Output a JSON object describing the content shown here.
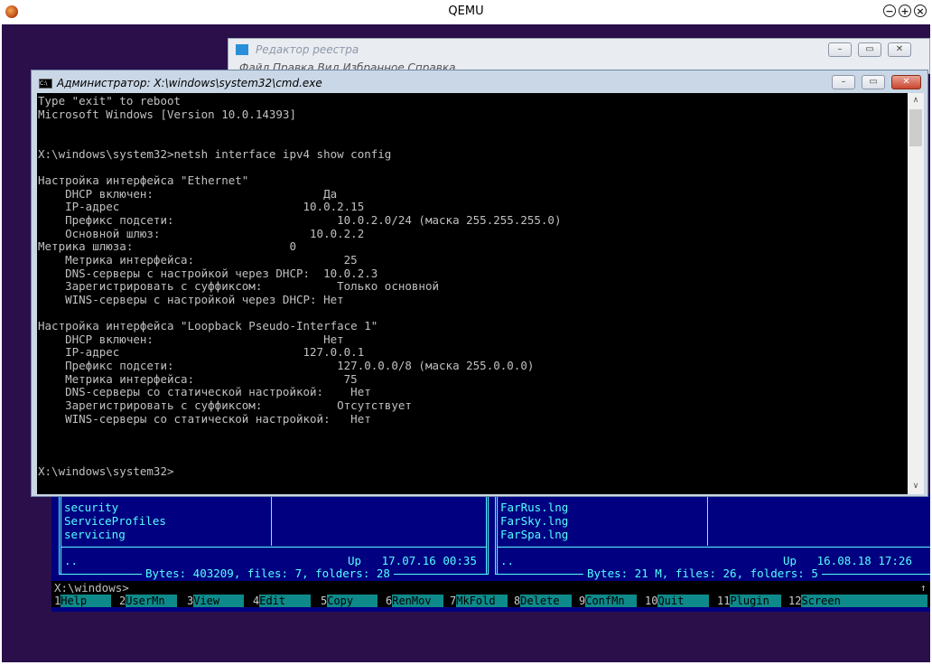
{
  "qemu": {
    "title": "QEMU",
    "minimize_glyph": "−",
    "maximize_glyph": "+",
    "close_glyph": "×"
  },
  "regedit": {
    "title": "Редактор реестра",
    "menu": "Файл   Правка   Вид   Избранное   Справка"
  },
  "cmd": {
    "title": "Администратор: X:\\windows\\system32\\cmd.exe",
    "lines": [
      "Type \"exit\" to reboot",
      "Microsoft Windows [Version 10.0.14393]",
      "",
      "",
      "X:\\windows\\system32>netsh interface ipv4 show config",
      "",
      "Настройка интерфейса \"Ethernet\"",
      "    DHCP включен:                         Да",
      "    IP-адрес                           10.0.2.15",
      "    Префикс подсети:                        10.0.2.0/24 (маска 255.255.255.0)",
      "    Основной шлюз:                      10.0.2.2",
      "Метрика шлюза:                       0",
      "    Метрика интерфейса:                      25",
      "    DNS-серверы с настройкой через DHCP:  10.0.2.3",
      "    Зарегистрировать с суффиксом:           Только основной",
      "    WINS-серверы с настройкой через DHCP: Нет",
      "",
      "Настройка интерфейса \"Loopback Pseudo-Interface 1\"",
      "    DHCP включен:                         Нет",
      "    IP-адрес                           127.0.0.1",
      "    Префикс подсети:                        127.0.0.0/8 (маска 255.0.0.0)",
      "    Метрика интерфейса:                      75",
      "    DNS-серверы со статической настройкой:    Нет",
      "    Зарегистрировать с суффиксом:           Отсутствует",
      "    WINS-серверы со статической настройкой:   Нет",
      "",
      "",
      "",
      "X:\\windows\\system32>"
    ]
  },
  "far": {
    "left_panel": {
      "files": [
        "security",
        "ServiceProfiles",
        "servicing"
      ],
      "selected": "..",
      "info": "Up   17.07.16 00:35",
      "summary": "Bytes: 403209, files: 7, folders: 28"
    },
    "right_panel": {
      "files": [
        "FarRus.lng",
        "FarSky.lng",
        "FarSpa.lng"
      ],
      "selected": "..",
      "info": "Up   16.08.18 17:26",
      "summary": "Bytes: 21 M, files: 26, folders: 5"
    },
    "prompt": "X:\\windows>",
    "keybar": [
      {
        "num": "1",
        "label": "Help"
      },
      {
        "num": "2",
        "label": "UserMn"
      },
      {
        "num": "3",
        "label": "View"
      },
      {
        "num": "4",
        "label": "Edit"
      },
      {
        "num": "5",
        "label": "Copy"
      },
      {
        "num": "6",
        "label": "RenMov"
      },
      {
        "num": "7",
        "label": "MkFold"
      },
      {
        "num": "8",
        "label": "Delete"
      },
      {
        "num": "9",
        "label": "ConfMn"
      },
      {
        "num": "10",
        "label": "Quit"
      },
      {
        "num": "11",
        "label": "Plugin"
      },
      {
        "num": "12",
        "label": "Screen"
      }
    ]
  }
}
